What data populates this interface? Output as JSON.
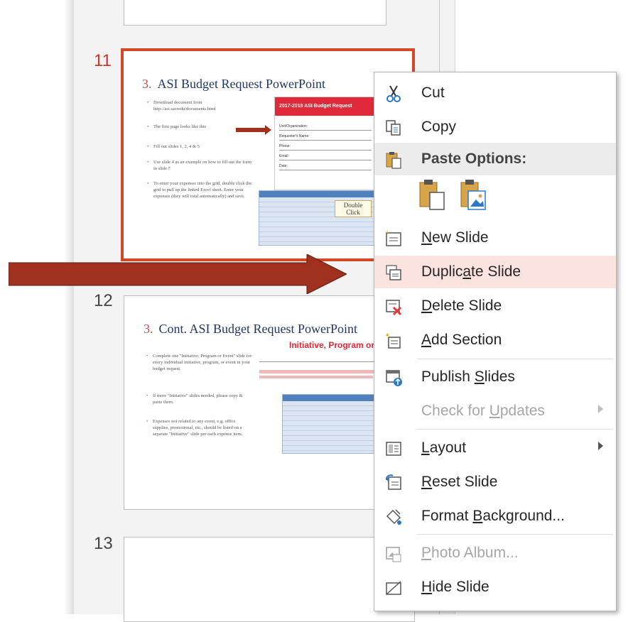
{
  "slides": [
    {
      "number": "11",
      "title_num": "3.",
      "title": "ASI Budget Request PowerPoint",
      "bullets": [
        "Download document from http://asi.sacredu/documents.html",
        "The first page looks like this",
        "Fill out slides 1, 2, 4 & 5",
        "Use slide 4 as an example on how to fill out the form in slide 7",
        "To enter your expenses into the grid, double click the grid to pull up the linked Excel sheet. Enter your expenses (they will total automatically) and save."
      ],
      "doc_header": "2017-2018 ASI Budget Request",
      "doc_fields": [
        "Unit/Organization:",
        "Requester's Name:",
        "Phone:",
        "Email:",
        "Date:"
      ],
      "callout": "Double Click"
    },
    {
      "number": "12",
      "title_num": "3.",
      "title": "Cont. ASI Budget Request PowerPoint",
      "subtitle": "Initiative, Program or Eve",
      "bullets": [
        "Complete one \"Initiative, Program or Event\" slide for every individual initiative, program, or event in your budget request.",
        "If more \"Initiative\" slides needed, please copy & paste them.",
        "Expenses not related to any event, e.g. office supplies, promotional, etc., should be listed on a separate \"Initiative\" slide per each expense item."
      ]
    },
    {
      "number": "13"
    }
  ],
  "context_menu": {
    "items": [
      {
        "label": "Cut",
        "icon": "scissors-icon",
        "enabled": true
      },
      {
        "label": "Copy",
        "icon": "copy-icon",
        "enabled": true
      },
      {
        "label": "Paste Options:",
        "icon": "paste-icon",
        "enabled": true,
        "header": true
      },
      {
        "label": "New Slide",
        "icon": "new-slide-icon",
        "enabled": true
      },
      {
        "label": "Duplicate Slide",
        "icon": "duplicate-slide-icon",
        "enabled": true,
        "highlighted": true
      },
      {
        "label": "Delete Slide",
        "icon": "delete-slide-icon",
        "enabled": true
      },
      {
        "label": "Add Section",
        "icon": "add-section-icon",
        "enabled": true
      },
      {
        "label": "Publish Slides",
        "icon": "publish-slides-icon",
        "enabled": true
      },
      {
        "label": "Check for Updates",
        "icon": "",
        "enabled": false,
        "submenu": true
      },
      {
        "label": "Layout",
        "icon": "layout-icon",
        "enabled": true,
        "submenu": true
      },
      {
        "label": "Reset Slide",
        "icon": "reset-slide-icon",
        "enabled": true
      },
      {
        "label": "Format Background...",
        "icon": "format-background-icon",
        "enabled": true
      },
      {
        "label": "Photo Album...",
        "icon": "photo-album-icon",
        "enabled": false
      },
      {
        "label": "Hide Slide",
        "icon": "hide-slide-icon",
        "enabled": true
      }
    ],
    "paste_options": [
      "use-destination-theme-icon",
      "picture-paste-icon"
    ]
  },
  "colors": {
    "accent": "#d24726",
    "arrow": "#a0311f",
    "highlight": "#fbe4df",
    "header_bg": "#ececec"
  }
}
